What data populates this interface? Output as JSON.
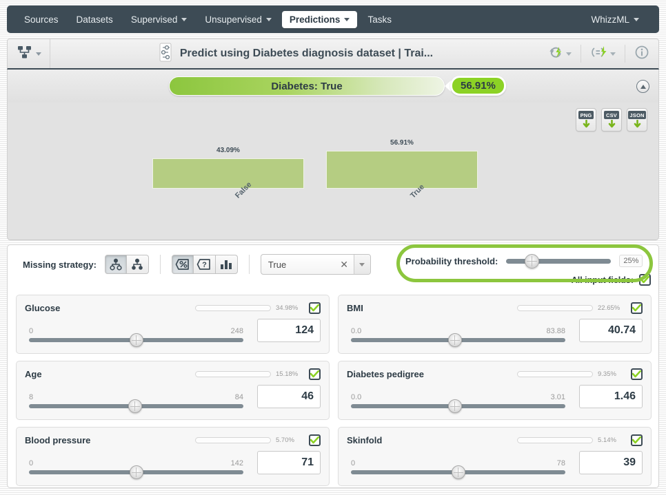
{
  "nav": {
    "items": [
      {
        "label": "Sources",
        "caret": false,
        "active": false
      },
      {
        "label": "Datasets",
        "caret": false,
        "active": false
      },
      {
        "label": "Supervised",
        "caret": true,
        "active": false
      },
      {
        "label": "Unsupervised",
        "caret": true,
        "active": false
      },
      {
        "label": "Predictions",
        "caret": true,
        "active": true
      },
      {
        "label": "Tasks",
        "caret": false,
        "active": false
      }
    ],
    "account": {
      "label": "WhizzML",
      "caret": true
    }
  },
  "titlebar": {
    "model_icon": "decision-tree-icon",
    "sliders_icon": "sliders-icon",
    "title": "Predict using Diabetes diagnosis dataset | Trai...",
    "actions": [
      {
        "icon": "refresh-lightning-icon",
        "caret": true
      },
      {
        "icon": "batch-lightning-icon",
        "caret": true
      },
      {
        "icon": "info-icon",
        "caret": false
      }
    ]
  },
  "prediction": {
    "label": "Diabetes: True",
    "score": "56.91%",
    "collapse_icon": "collapse-up-icon"
  },
  "exports": [
    {
      "label": "PNG",
      "icon": "download-icon"
    },
    {
      "label": "CSV",
      "icon": "download-icon"
    },
    {
      "label": "JSON",
      "icon": "download-icon"
    }
  ],
  "chart_data": {
    "type": "bar",
    "title": "",
    "xlabel": "",
    "ylabel": "",
    "categories": [
      "False",
      "True"
    ],
    "values": [
      43.09,
      56.91
    ],
    "value_labels": [
      "43.09%",
      "56.91%"
    ],
    "ylim": [
      0,
      100
    ],
    "grid": false,
    "legend": false,
    "orientation": "vertical",
    "bar_color": "#b5cd82"
  },
  "controls": {
    "missing_strategy_label": "Missing strategy:",
    "missing_strategy_buttons": [
      {
        "icon": "tree-last-prediction-icon",
        "selected": true
      },
      {
        "icon": "tree-proportional-icon",
        "selected": false
      }
    ],
    "view_buttons": [
      {
        "icon": "percent-icon",
        "selected": true
      },
      {
        "icon": "question-icon",
        "selected": false
      },
      {
        "icon": "histogram-icon",
        "selected": false
      }
    ],
    "class_select": {
      "value": "True",
      "clear_icon": "clear-icon",
      "arrow_icon": "chevron-down-icon"
    },
    "threshold": {
      "label": "Probability threshold:",
      "value": "25%",
      "percent": 25
    },
    "all_input_fields": {
      "label": "All input fields:",
      "checked": true
    }
  },
  "fields": [
    {
      "name": "Glucose",
      "importance": "34.98%",
      "importance_pct": 34.98,
      "min": "0",
      "max": "248",
      "value": "124",
      "value_pct": 50,
      "checked": true
    },
    {
      "name": "BMI",
      "importance": "22.65%",
      "importance_pct": 22.65,
      "min": "0.0",
      "max": "83.88",
      "value": "40.74",
      "value_pct": 48.5,
      "checked": true
    },
    {
      "name": "Age",
      "importance": "15.18%",
      "importance_pct": 15.18,
      "min": "8",
      "max": "84",
      "value": "46",
      "value_pct": 50,
      "checked": true
    },
    {
      "name": "Diabetes pedigree",
      "importance": "9.35%",
      "importance_pct": 9.35,
      "min": "0.0",
      "max": "3.01",
      "value": "1.46",
      "value_pct": 48.5,
      "checked": true
    },
    {
      "name": "Blood pressure",
      "importance": "5.70%",
      "importance_pct": 5.7,
      "min": "0",
      "max": "142",
      "value": "71",
      "value_pct": 50,
      "checked": true
    },
    {
      "name": "Skinfold",
      "importance": "5.14%",
      "importance_pct": 5.14,
      "min": "0",
      "max": "78",
      "value": "39",
      "value_pct": 50,
      "checked": true
    }
  ],
  "colors": {
    "nav_bg": "#3d4b55",
    "accent_green": "#8cd225",
    "bar_green": "#b5cd82",
    "ring_green": "#8cc63e"
  }
}
